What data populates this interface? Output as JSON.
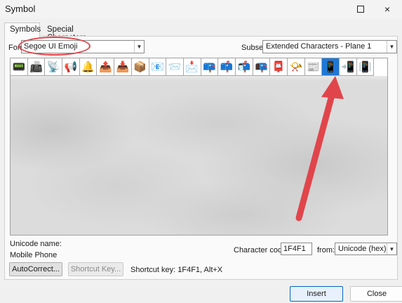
{
  "window": {
    "title": "Symbol",
    "maximize_icon": "maximize-icon",
    "close_icon": "×"
  },
  "tabs": [
    {
      "label": "Symbols",
      "active": true
    },
    {
      "label": "Special Characters",
      "active": false
    }
  ],
  "font": {
    "label": "Font:",
    "value": "Segoe UI Emoji"
  },
  "subset": {
    "label": "Subset:",
    "value": "Extended Characters - Plane 1"
  },
  "grid": {
    "row1": [
      "📟",
      "📠",
      "📡",
      "📢",
      "🔔",
      "📤",
      "📥",
      "📦",
      "📧",
      "📨",
      "📩",
      "📪",
      "📫",
      "📬",
      "📭",
      "📮",
      "📯",
      "📰",
      "📱",
      "📲",
      "📳"
    ],
    "row2": [
      "📴",
      "🔅",
      "🔆",
      "🔇",
      "🔈",
      "🔉",
      "🔊",
      "🔋",
      "🔌",
      "🔍",
      "🔎",
      "🔏",
      "🔐",
      "🔑",
      "🔒",
      "🔓",
      "🔔",
      "🔕",
      "🔖",
      "🔗",
      "🔘"
    ],
    "selected_index": 18
  },
  "unicode_name": {
    "label": "Unicode name:",
    "value": "Mobile Phone"
  },
  "character_code": {
    "label": "Character code:",
    "value": "1F4F1"
  },
  "from": {
    "label": "from:",
    "value": "Unicode (hex)"
  },
  "buttons": {
    "autocorrect": "AutoCorrect...",
    "shortcut_key": "Shortcut Key...",
    "insert": "Insert",
    "close": "Close"
  },
  "shortcut_info": "Shortcut key: 1F4F1, Alt+X",
  "colors": {
    "accent": "#1e78d7",
    "annotation": "#e0454b"
  }
}
